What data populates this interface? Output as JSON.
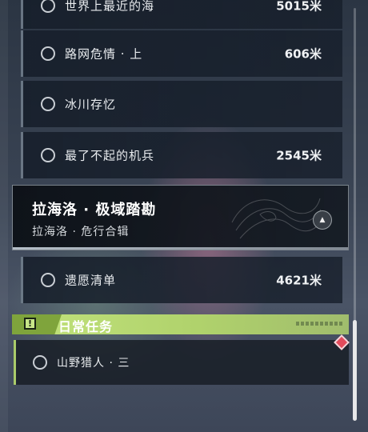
{
  "quests": [
    {
      "title": "世界上最近的海",
      "distance": "5015米"
    },
    {
      "title": "路网危情 · 上",
      "distance": "606米"
    },
    {
      "title": "冰川存忆",
      "distance": ""
    },
    {
      "title": "最了不起的机兵",
      "distance": "2545米"
    }
  ],
  "chapter": {
    "title": "拉海洛 · 极域踏勘",
    "subtitle": "拉海洛 · 危行合辑",
    "toggle_icon": "chevron-up-icon"
  },
  "chapter_quests": [
    {
      "title": "遗愿清单",
      "distance": "4621米"
    }
  ],
  "daily": {
    "header": "日常任务",
    "icon": "exclamation-icon",
    "quests": [
      {
        "title": "山野猎人 · 三"
      }
    ]
  },
  "colors": {
    "daily_accent": "#c2e37c",
    "new_badge": "#e24b5c"
  }
}
